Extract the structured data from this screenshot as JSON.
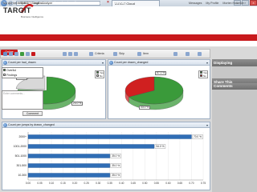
{
  "browser": {
    "address": "https://...?targit.c...",
    "tab_title": "TARGIT Cloud",
    "window_buttons": [
      "–",
      "▫",
      "×"
    ]
  },
  "header": {
    "logo": "TARGIT",
    "tagline": "Business Intelligence",
    "links": [
      "Messages",
      "My Profile",
      "Morten Hotteßen"
    ]
  },
  "nav": {
    "items": [
      "Analyze",
      "Pulse",
      "Upload And Subscribe",
      "Connect",
      "Support"
    ]
  },
  "breadcrumb": "You are here: TARGIT Cloud » Analyze",
  "toolbar": {
    "online_label": "Online",
    "criteria_label": "Criteria",
    "skip_label": "Skip",
    "item_label": "Item"
  },
  "panels": {
    "left_pie": {
      "title": "Count per had_drawn",
      "legend": [
        {
          "label": "Yes",
          "color": "#3a9a3a"
        },
        {
          "label": "No",
          "color": "#e0e0e0"
        }
      ],
      "labels": [
        "76.0 %",
        "24.0 %"
      ]
    },
    "right_pie": {
      "title": "Count per drawn_changed",
      "legend": [
        {
          "label": "Yes",
          "color": "#3a9a3a"
        },
        {
          "label": "No",
          "color": "#d02020"
        }
      ],
      "labels": [
        "67.0 %",
        "33.0 %"
      ]
    },
    "bar": {
      "title": "Count per jumps by drawn_changed"
    }
  },
  "chart_data": [
    {
      "type": "pie",
      "title": "Count per had_drawn",
      "categories": [
        "Yes",
        "No"
      ],
      "values": [
        76.0,
        24.0
      ],
      "legend": "top-right"
    },
    {
      "type": "pie",
      "title": "Count per drawn_changed",
      "categories": [
        "Yes",
        "No"
      ],
      "values": [
        67.0,
        33.0
      ],
      "legend": "top-right"
    },
    {
      "type": "bar",
      "orientation": "horizontal",
      "title": "Count per jumps by drawn_changed",
      "categories": [
        "2000+",
        "1001-2000",
        "501-1000",
        "301-500",
        "10-300"
      ],
      "values": [
        0.7,
        0.54,
        0.35,
        0.35,
        0.35
      ],
      "value_labels": [
        "70.0 %",
        "54.0 %",
        "35.0 %",
        "35.0 %",
        "35.0 %"
      ],
      "xlim": [
        0,
        0.75
      ],
      "xticks": [
        "0.00",
        "0.05",
        "0.10",
        "0.15",
        "0.20",
        "0.25",
        "0.30",
        "0.35",
        "0.40",
        "0.45",
        "0.50",
        "0.55",
        "0.60",
        "0.65",
        "0.70",
        "0.75"
      ],
      "grid": true
    }
  ],
  "sidebar": {
    "displaying_title": "Displaying",
    "items": [
      "Overlist",
      "Findings"
    ],
    "share_title": "Share This",
    "comments_title": "Comments",
    "comment_placeholder": "Enter comments...",
    "comment_button": "Comment"
  },
  "colors": {
    "nav_red": "#c8191c",
    "pie_green": "#3a9a3a",
    "pie_red": "#d02020",
    "bar_blue": "#2f6db5"
  }
}
